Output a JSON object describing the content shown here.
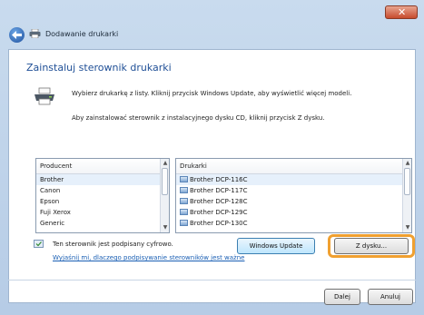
{
  "window": {
    "title": "Dodawanie drukarki",
    "close_label": "✕"
  },
  "main": {
    "heading": "Zainstaluj sterownik drukarki",
    "description_1": "Wybierz drukarkę z listy. Kliknij przycisk Windows Update, aby wyświetlić więcej modeli.",
    "description_2": "Aby zainstalować sterownik z instalacyjnego dysku CD, kliknij przycisk Z dysku."
  },
  "manufacturers": {
    "header": "Producent",
    "items": [
      "Brother",
      "Canon",
      "Epson",
      "Fuji Xerox",
      "Generic"
    ],
    "selected": "Brother"
  },
  "printers": {
    "header": "Drukarki",
    "items": [
      "Brother DCP-116C",
      "Brother DCP-117C",
      "Brother DCP-128C",
      "Brother DCP-129C",
      "Brother DCP-130C"
    ],
    "selected": "Brother DCP-116C"
  },
  "signing": {
    "status": "Ten sterownik jest podpisany cyfrowo.",
    "link": "Wyjaśnij mi, dlaczego podpisywanie sterowników jest ważne"
  },
  "buttons": {
    "windows_update": "Windows Update",
    "have_disk": "Z dysku...",
    "next": "Dalej",
    "cancel": "Anuluj"
  },
  "colors": {
    "heading": "#1f4f96",
    "link": "#1a5fb4",
    "highlight": "#f0a030"
  },
  "icons": {
    "back": "back-arrow-icon",
    "printer": "printer-icon",
    "shield": "signed-driver-icon"
  }
}
